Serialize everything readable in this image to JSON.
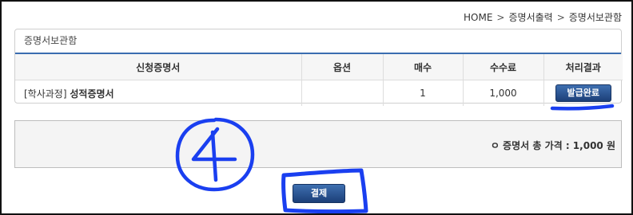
{
  "breadcrumb": {
    "items": [
      "HOME",
      "증명서출력",
      "증명서보관함"
    ],
    "separator": ">"
  },
  "panel": {
    "title": "증명서보관함"
  },
  "table": {
    "headers": [
      "신청증명서",
      "옵션",
      "매수",
      "수수료",
      "처리결과"
    ],
    "rows": [
      {
        "prefix": "[학사과정]",
        "name": "성적증명서",
        "option": "",
        "count": "1",
        "fee": "1,000",
        "status_button": "발급완료"
      }
    ]
  },
  "summary": {
    "text": "ㅇ 증명서 총 가격 : 1,000 원"
  },
  "actions": {
    "pay_label": "결제"
  },
  "annotations": {
    "handwritten_number": "4",
    "ink_color": "#1a3ff0"
  },
  "colors": {
    "accent_blue": "#3a6db0",
    "button_top": "#3e6fb0",
    "button_bottom": "#1c3f78"
  }
}
